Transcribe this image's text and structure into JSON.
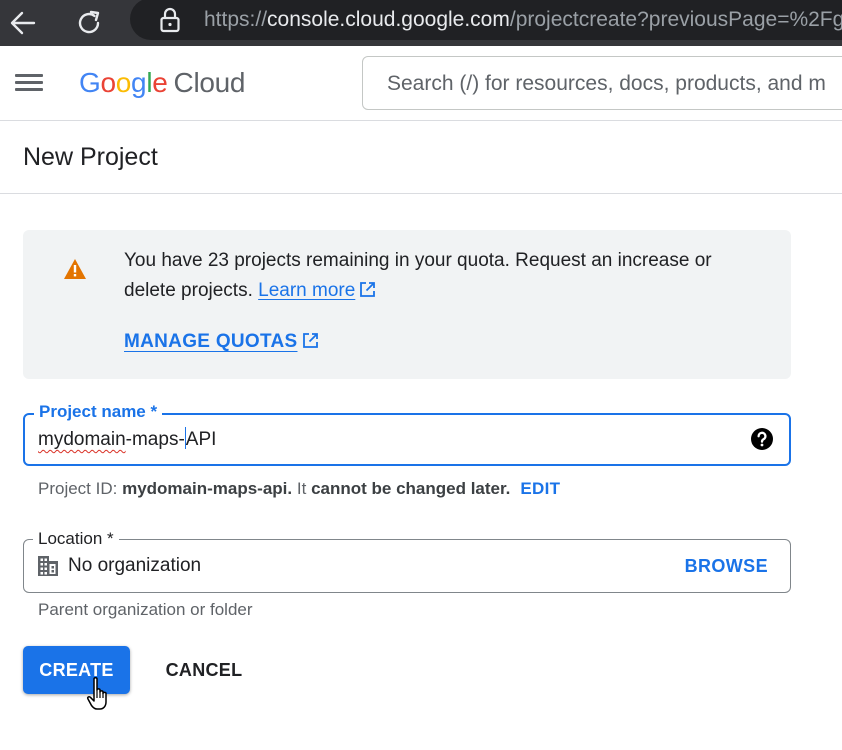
{
  "browser": {
    "url_scheme": "https://",
    "url_host": "console.cloud.google.com",
    "url_path": "/projectcreate?previousPage=%2Fg"
  },
  "header": {
    "logo_letters": [
      "G",
      "o",
      "o",
      "g",
      "l",
      "e"
    ],
    "logo_suffix": "Cloud",
    "search_placeholder": "Search (/) for resources, docs, products, and m"
  },
  "page": {
    "title": "New Project"
  },
  "quota_notice": {
    "text": "You have 23 projects remaining in your quota. Request an increase or delete projects.",
    "learn_more": "Learn more",
    "manage_quotas": "MANAGE QUOTAS"
  },
  "project_name": {
    "label": "Project name *",
    "value_underlined": "mydomain",
    "value_before_caret": "-maps-",
    "value_after_caret": "API"
  },
  "project_id": {
    "prefix": "Project ID:",
    "id": "mydomain-maps-api.",
    "mid": "It",
    "suffix": "cannot be changed later.",
    "edit": "EDIT"
  },
  "location": {
    "label": "Location *",
    "value": "No organization",
    "browse": "BROWSE",
    "hint": "Parent organization or folder"
  },
  "actions": {
    "create": "CREATE",
    "cancel": "CANCEL"
  },
  "colors": {
    "accent": "#1a73e8",
    "warning": "#e37400",
    "browser_bar": "#35363a"
  },
  "icons": {
    "back": "back-arrow-icon",
    "reload": "reload-icon",
    "lock": "lock-icon",
    "menu": "hamburger-menu-icon",
    "warning": "warning-icon",
    "external": "external-link-icon",
    "help": "help-icon",
    "organization": "building-icon",
    "cursor": "hand-pointer-cursor-icon"
  }
}
